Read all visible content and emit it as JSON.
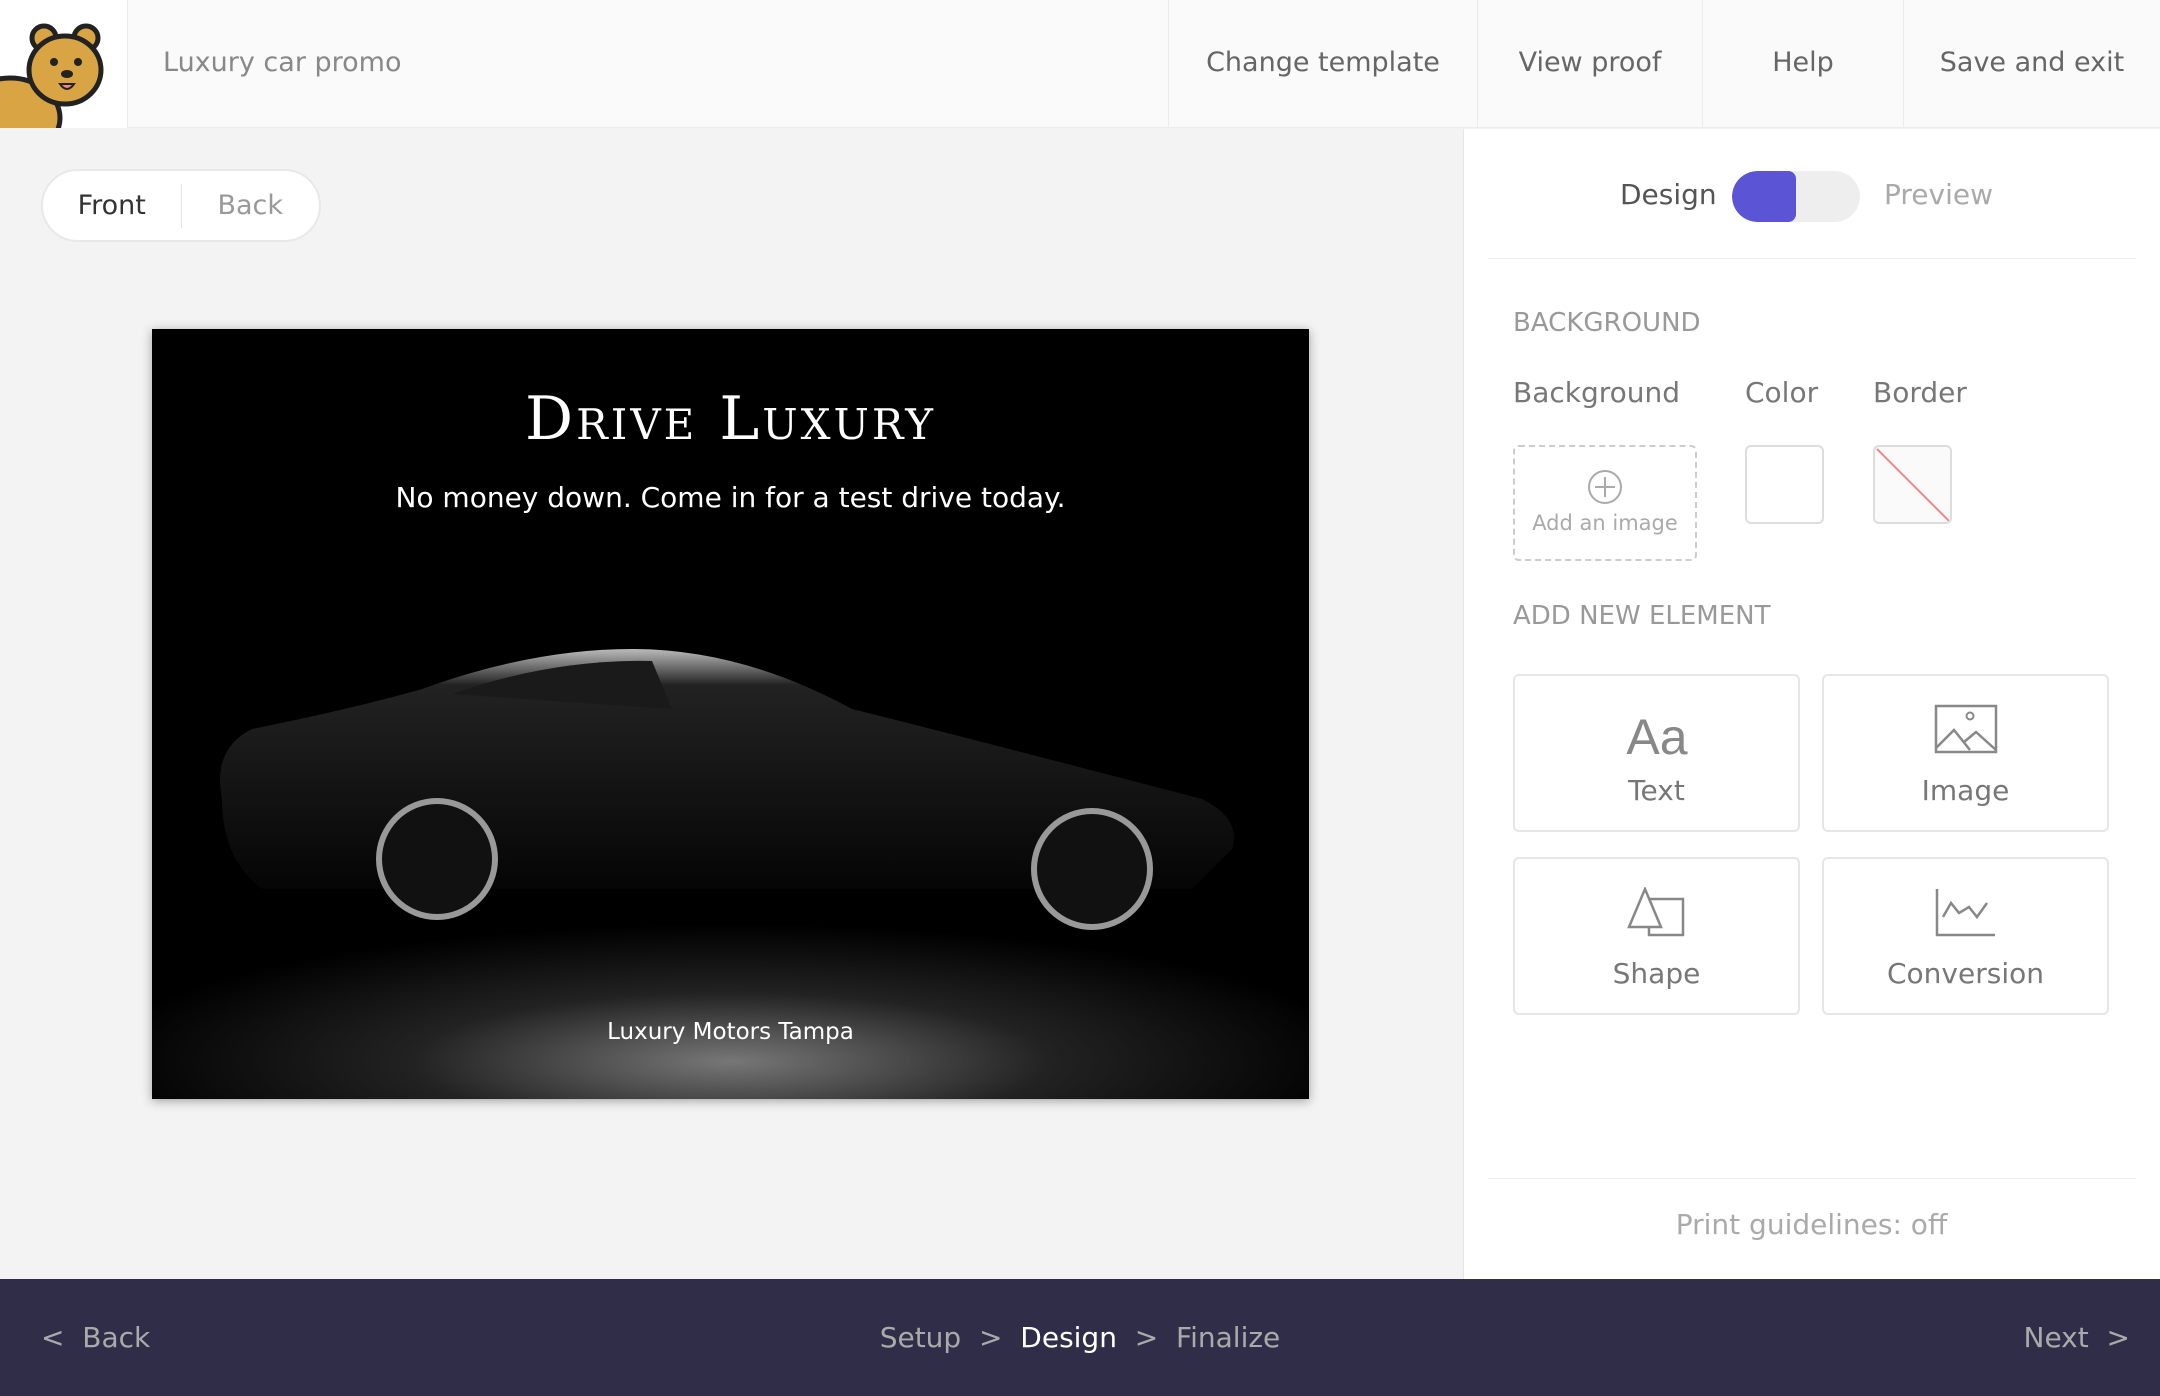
{
  "header": {
    "title": "Luxury car promo",
    "nav": [
      "Change template",
      "View proof",
      "Help",
      "Save and exit"
    ]
  },
  "canvas": {
    "sides": {
      "front": "Front",
      "back": "Back"
    },
    "card": {
      "headline": "Drive Luxury",
      "subline": "No money down. Come in for a test drive today.",
      "footer": "Luxury Motors Tampa"
    }
  },
  "panel": {
    "mode": {
      "design": "Design",
      "preview": "Preview",
      "active": "Design"
    },
    "background_section": "BACKGROUND",
    "bg_labels": {
      "background": "Background",
      "color": "Color",
      "border": "Border"
    },
    "add_image": "Add an image",
    "add_element_section": "ADD NEW ELEMENT",
    "tiles": [
      {
        "label": "Text",
        "icon": "text-icon"
      },
      {
        "label": "Image",
        "icon": "image-icon"
      },
      {
        "label": "Shape",
        "icon": "shape-icon"
      },
      {
        "label": "Conversion",
        "icon": "chart-icon"
      }
    ],
    "print_guidelines": "Print guidelines: off"
  },
  "footer": {
    "back": "Back",
    "steps": [
      "Setup",
      "Design",
      "Finalize"
    ],
    "current_step": "Design",
    "next": "Next"
  },
  "colors": {
    "accent": "#5b55d6",
    "footer_bg": "#302d48"
  }
}
